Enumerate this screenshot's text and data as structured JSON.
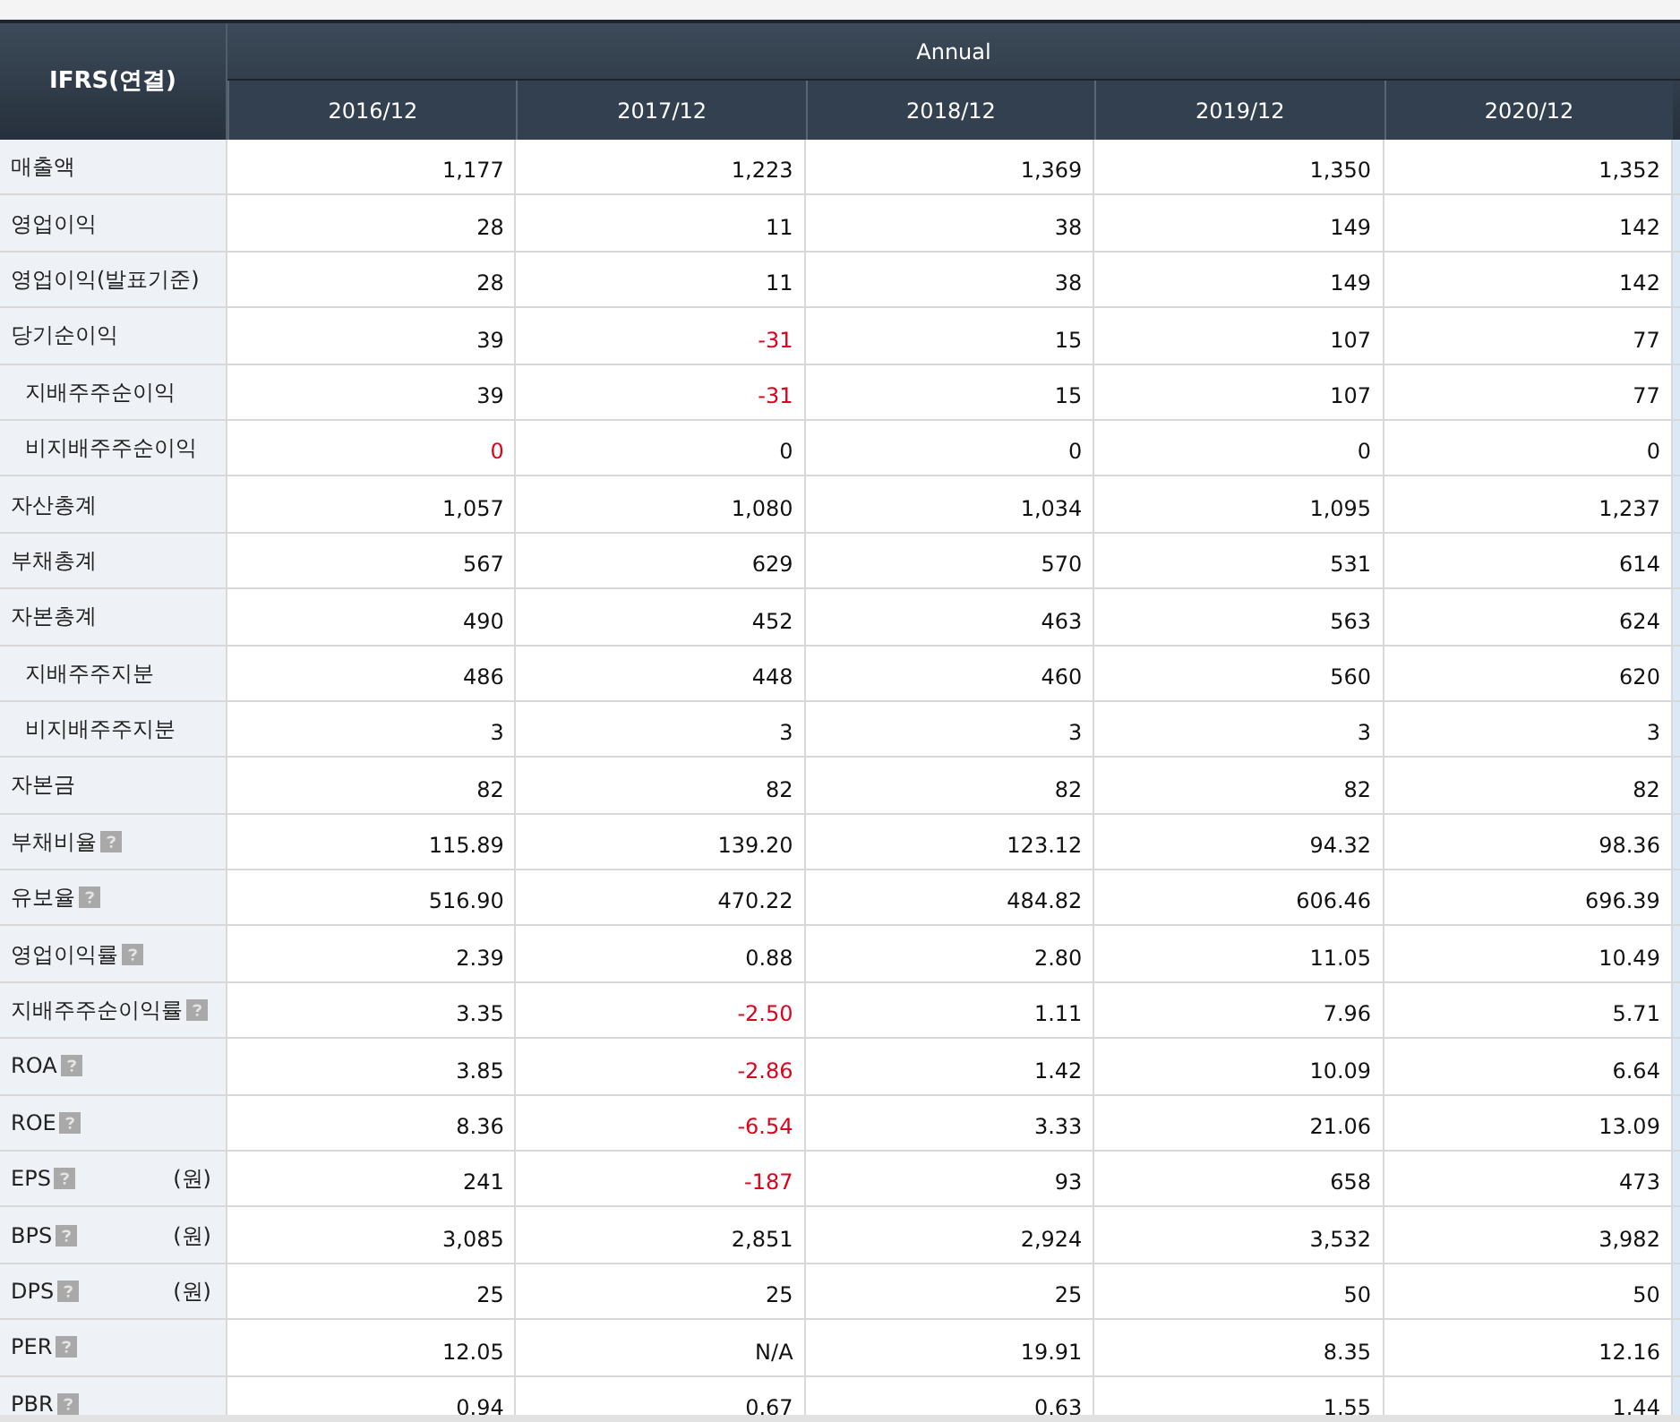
{
  "table": {
    "corner": "IFRS(연결)",
    "group": "Annual",
    "columns": [
      "2016/12",
      "2017/12",
      "2018/12",
      "2019/12",
      "2020/12"
    ],
    "rows": [
      {
        "label": "매출액",
        "help": false,
        "cells": [
          {
            "text": "1,177",
            "red": false
          },
          {
            "text": "1,223",
            "red": false
          },
          {
            "text": "1,369",
            "red": false
          },
          {
            "text": "1,350",
            "red": false
          },
          {
            "text": "1,352",
            "red": false
          }
        ]
      },
      {
        "label": "영업이익",
        "help": false,
        "cells": [
          {
            "text": "28",
            "red": false
          },
          {
            "text": "11",
            "red": false
          },
          {
            "text": "38",
            "red": false
          },
          {
            "text": "149",
            "red": false
          },
          {
            "text": "142",
            "red": false
          }
        ]
      },
      {
        "label": "영업이익(발표기준)",
        "help": false,
        "cells": [
          {
            "text": "28",
            "red": false
          },
          {
            "text": "11",
            "red": false
          },
          {
            "text": "38",
            "red": false
          },
          {
            "text": "149",
            "red": false
          },
          {
            "text": "142",
            "red": false
          }
        ]
      },
      {
        "label": "당기순이익",
        "help": false,
        "cells": [
          {
            "text": "39",
            "red": false
          },
          {
            "text": "-31",
            "red": true
          },
          {
            "text": "15",
            "red": false
          },
          {
            "text": "107",
            "red": false
          },
          {
            "text": "77",
            "red": false
          }
        ],
        "children": [
          {
            "label": "지배주주순이익",
            "help": false,
            "cells": [
              {
                "text": "39",
                "red": false
              },
              {
                "text": "-31",
                "red": true
              },
              {
                "text": "15",
                "red": false
              },
              {
                "text": "107",
                "red": false
              },
              {
                "text": "77",
                "red": false
              }
            ]
          },
          {
            "label": "비지배주주순이익",
            "help": false,
            "cells": [
              {
                "text": "0",
                "red": true
              },
              {
                "text": "0",
                "red": false
              },
              {
                "text": "0",
                "red": false
              },
              {
                "text": "0",
                "red": false
              },
              {
                "text": "0",
                "red": false
              }
            ]
          }
        ]
      },
      {
        "label": "자산총계",
        "help": false,
        "cells": [
          {
            "text": "1,057",
            "red": false
          },
          {
            "text": "1,080",
            "red": false
          },
          {
            "text": "1,034",
            "red": false
          },
          {
            "text": "1,095",
            "red": false
          },
          {
            "text": "1,237",
            "red": false
          }
        ]
      },
      {
        "label": "부채총계",
        "help": false,
        "cells": [
          {
            "text": "567",
            "red": false
          },
          {
            "text": "629",
            "red": false
          },
          {
            "text": "570",
            "red": false
          },
          {
            "text": "531",
            "red": false
          },
          {
            "text": "614",
            "red": false
          }
        ]
      },
      {
        "label": "자본총계",
        "help": false,
        "cells": [
          {
            "text": "490",
            "red": false
          },
          {
            "text": "452",
            "red": false
          },
          {
            "text": "463",
            "red": false
          },
          {
            "text": "563",
            "red": false
          },
          {
            "text": "624",
            "red": false
          }
        ],
        "children": [
          {
            "label": "지배주주지분",
            "help": false,
            "cells": [
              {
                "text": "486",
                "red": false
              },
              {
                "text": "448",
                "red": false
              },
              {
                "text": "460",
                "red": false
              },
              {
                "text": "560",
                "red": false
              },
              {
                "text": "620",
                "red": false
              }
            ]
          },
          {
            "label": "비지배주주지분",
            "help": false,
            "cells": [
              {
                "text": "3",
                "red": false
              },
              {
                "text": "3",
                "red": false
              },
              {
                "text": "3",
                "red": false
              },
              {
                "text": "3",
                "red": false
              },
              {
                "text": "3",
                "red": false
              }
            ]
          }
        ]
      },
      {
        "label": "자본금",
        "help": false,
        "cells": [
          {
            "text": "82",
            "red": false
          },
          {
            "text": "82",
            "red": false
          },
          {
            "text": "82",
            "red": false
          },
          {
            "text": "82",
            "red": false
          },
          {
            "text": "82",
            "red": false
          }
        ]
      },
      {
        "label": "부채비율",
        "help": true,
        "cells": [
          {
            "text": "115.89",
            "red": false
          },
          {
            "text": "139.20",
            "red": false
          },
          {
            "text": "123.12",
            "red": false
          },
          {
            "text": "94.32",
            "red": false
          },
          {
            "text": "98.36",
            "red": false
          }
        ]
      },
      {
        "label": "유보율",
        "help": true,
        "cells": [
          {
            "text": "516.90",
            "red": false
          },
          {
            "text": "470.22",
            "red": false
          },
          {
            "text": "484.82",
            "red": false
          },
          {
            "text": "606.46",
            "red": false
          },
          {
            "text": "696.39",
            "red": false
          }
        ]
      },
      {
        "label": "영업이익률",
        "help": true,
        "cells": [
          {
            "text": "2.39",
            "red": false
          },
          {
            "text": "0.88",
            "red": false
          },
          {
            "text": "2.80",
            "red": false
          },
          {
            "text": "11.05",
            "red": false
          },
          {
            "text": "10.49",
            "red": false
          }
        ]
      },
      {
        "label": "지배주주순이익률",
        "help": true,
        "cells": [
          {
            "text": "3.35",
            "red": false
          },
          {
            "text": "-2.50",
            "red": true
          },
          {
            "text": "1.11",
            "red": false
          },
          {
            "text": "7.96",
            "red": false
          },
          {
            "text": "5.71",
            "red": false
          }
        ]
      },
      {
        "label": "ROA",
        "help": true,
        "cells": [
          {
            "text": "3.85",
            "red": false
          },
          {
            "text": "-2.86",
            "red": true
          },
          {
            "text": "1.42",
            "red": false
          },
          {
            "text": "10.09",
            "red": false
          },
          {
            "text": "6.64",
            "red": false
          }
        ]
      },
      {
        "label": "ROE",
        "help": true,
        "cells": [
          {
            "text": "8.36",
            "red": false
          },
          {
            "text": "-6.54",
            "red": true
          },
          {
            "text": "3.33",
            "red": false
          },
          {
            "text": "21.06",
            "red": false
          },
          {
            "text": "13.09",
            "red": false
          }
        ]
      },
      {
        "label": "EPS",
        "help": true,
        "unit": "(원)",
        "cells": [
          {
            "text": "241",
            "red": false
          },
          {
            "text": "-187",
            "red": true
          },
          {
            "text": "93",
            "red": false
          },
          {
            "text": "658",
            "red": false
          },
          {
            "text": "473",
            "red": false
          }
        ]
      },
      {
        "label": "BPS",
        "help": true,
        "unit": "(원)",
        "cells": [
          {
            "text": "3,085",
            "red": false
          },
          {
            "text": "2,851",
            "red": false
          },
          {
            "text": "2,924",
            "red": false
          },
          {
            "text": "3,532",
            "red": false
          },
          {
            "text": "3,982",
            "red": false
          }
        ]
      },
      {
        "label": "DPS",
        "help": true,
        "unit": "(원)",
        "cells": [
          {
            "text": "25",
            "red": false
          },
          {
            "text": "25",
            "red": false
          },
          {
            "text": "25",
            "red": false
          },
          {
            "text": "50",
            "red": false
          },
          {
            "text": "50",
            "red": false
          }
        ]
      },
      {
        "label": "PER",
        "help": true,
        "cells": [
          {
            "text": "12.05",
            "red": false
          },
          {
            "text": "N/A",
            "red": false
          },
          {
            "text": "19.91",
            "red": false
          },
          {
            "text": "8.35",
            "red": false
          },
          {
            "text": "12.16",
            "red": false
          }
        ]
      },
      {
        "label": "PBR",
        "help": true,
        "cells": [
          {
            "text": "0.94",
            "red": false
          },
          {
            "text": "0.67",
            "red": false
          },
          {
            "text": "0.63",
            "red": false
          },
          {
            "text": "1.55",
            "red": false
          },
          {
            "text": "1.44",
            "red": false
          }
        ]
      }
    ]
  }
}
